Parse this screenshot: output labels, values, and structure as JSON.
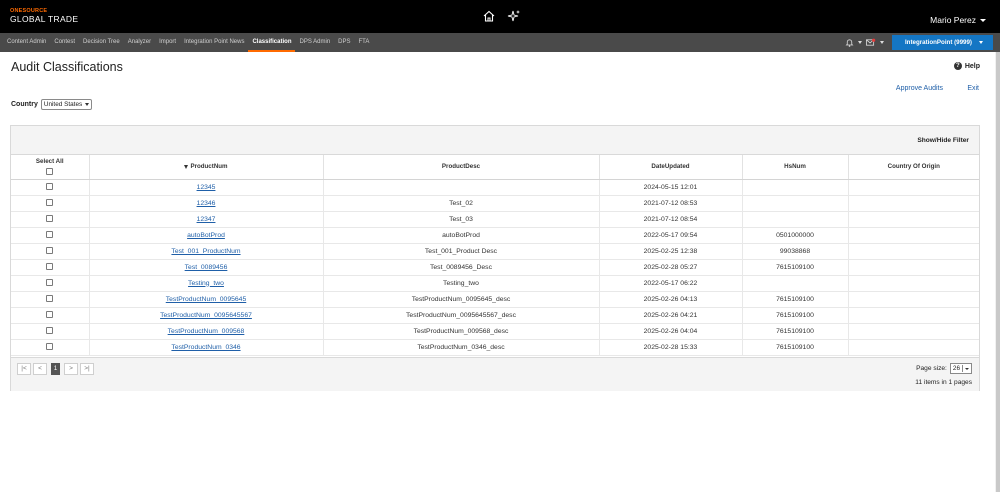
{
  "brand": {
    "top": "ONESOURCE",
    "bottom": "GLOBAL TRADE"
  },
  "header": {
    "user_name": "Mario Perez",
    "icons": [
      "home-icon",
      "sparkle-icon"
    ]
  },
  "nav": {
    "tabs": [
      {
        "label": "Content Admin",
        "active": false
      },
      {
        "label": "Contest",
        "active": false
      },
      {
        "label": "Decision Tree",
        "active": false
      },
      {
        "label": "Analyzer",
        "active": false
      },
      {
        "label": "Import",
        "active": false
      },
      {
        "label": "Integration Point News",
        "active": false
      },
      {
        "label": "Classification",
        "active": true
      },
      {
        "label": "DPS Admin",
        "active": false
      },
      {
        "label": "DPS",
        "active": false
      },
      {
        "label": "FTA",
        "active": false
      }
    ],
    "env_button": "IntegrationPoint (9999)",
    "accent_color": "#ff6a00",
    "button_color": "#1476c4"
  },
  "page": {
    "title": "Audit Classifications",
    "help": "Help",
    "approve_audits": "Approve Audits",
    "exit": "Exit",
    "country_label": "Country",
    "country_value": "United States"
  },
  "grid": {
    "show_hide_filter": "Show/Hide Filter",
    "select_all": "Select All",
    "columns": [
      "ProductNum",
      "ProductDesc",
      "DateUpdated",
      "HsNum",
      "Country Of Origin"
    ],
    "rows": [
      {
        "product_num": "12345",
        "product_desc": "",
        "date_updated": "2024-05-15 12:01",
        "hs_num": "",
        "country_of_origin": ""
      },
      {
        "product_num": "12346",
        "product_desc": "Test_02",
        "date_updated": "2021-07-12 08:53",
        "hs_num": "",
        "country_of_origin": ""
      },
      {
        "product_num": "12347",
        "product_desc": "Test_03",
        "date_updated": "2021-07-12 08:54",
        "hs_num": "",
        "country_of_origin": ""
      },
      {
        "product_num": "autoBotProd",
        "product_desc": "autoBotProd",
        "date_updated": "2022-05-17 09:54",
        "hs_num": "0501000000",
        "country_of_origin": ""
      },
      {
        "product_num": "Test_001_ProductNum",
        "product_desc": "Test_001_Product Desc",
        "date_updated": "2025-02-25 12:38",
        "hs_num": "99038868",
        "country_of_origin": ""
      },
      {
        "product_num": "Test_0089456",
        "product_desc": "Test_0089456_Desc",
        "date_updated": "2025-02-28 05:27",
        "hs_num": "7615109100",
        "country_of_origin": ""
      },
      {
        "product_num": "Testing_two",
        "product_desc": "Testing_two",
        "date_updated": "2022-05-17 06:22",
        "hs_num": "",
        "country_of_origin": ""
      },
      {
        "product_num": "TestProductNum_0095645",
        "product_desc": "TestProductNum_0095645_desc",
        "date_updated": "2025-02-26 04:13",
        "hs_num": "7615109100",
        "country_of_origin": ""
      },
      {
        "product_num": "TestProductNum_0095645567",
        "product_desc": "TestProductNum_0095645567_desc",
        "date_updated": "2025-02-26 04:21",
        "hs_num": "7615109100",
        "country_of_origin": ""
      },
      {
        "product_num": "TestProductNum_009568",
        "product_desc": "TestProductNum_009568_desc",
        "date_updated": "2025-02-26 04:04",
        "hs_num": "7615109100",
        "country_of_origin": ""
      },
      {
        "product_num": "TestProductNum_0346",
        "product_desc": "TestProductNum_0346_desc",
        "date_updated": "2025-02-28 15:33",
        "hs_num": "7615109100",
        "country_of_origin": ""
      }
    ],
    "pager": {
      "first": "|<",
      "prev": "<",
      "current": "1",
      "next": ">",
      "last": ">|"
    },
    "page_size_label": "Page size:",
    "page_size_value": "26",
    "items_count": "11 items in 1 pages"
  }
}
